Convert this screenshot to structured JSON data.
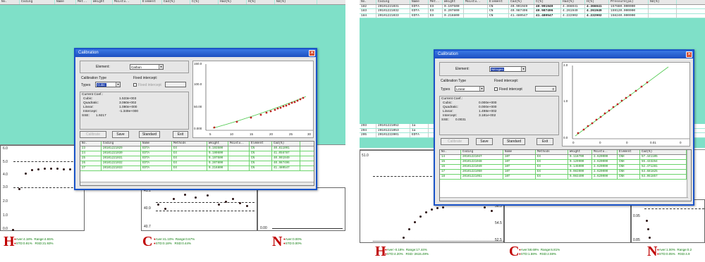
{
  "left": {
    "bg_headers": [
      "No.",
      "Coding",
      "Name",
      "Met..",
      "Weight",
      "Moistu..",
      "Element",
      "Cad(%)",
      "C(%)",
      "Had(%)",
      "H(%)",
      "Nd(%)"
    ],
    "dialog": {
      "title": "Calibration",
      "element_label": "Element:",
      "element_value": "Carbon",
      "calib_type_label": "Calibration Type",
      "types_label": "Types",
      "types_value": "Cubic",
      "fixed_intercept_label": "Fixed intercept:",
      "fixed_intercept_chk": "Fixed intercept",
      "coef_title": "Current Coef.:",
      "coefs": [
        {
          "k": "Cubic:",
          "v": "1.533e-003"
        },
        {
          "k": "Quadratic:",
          "v": "3.060e-002"
        },
        {
          "k": "Linear:",
          "v": "1.080e+000"
        },
        {
          "k": "Intercept:",
          "v": "-1.349e+000"
        },
        {
          "k": "SSE:",
          "v": "1.9217"
        }
      ],
      "buttons": {
        "calibrate": "Calibrate",
        "save": "Save",
        "standard": "Standard",
        "exit": "Exit"
      },
      "plot": {
        "y_ticks": [
          "150.0",
          "100.0",
          "50.00",
          "0.000"
        ],
        "x_ticks": [
          "5",
          "10",
          "15",
          "20",
          "25",
          "30"
        ]
      },
      "table_headers": [
        "No.",
        "Coding",
        "Name",
        "Methods",
        "Weight",
        "Moistu..",
        "Element",
        "Cad(%)"
      ],
      "rows": [
        [
          "23",
          "20101221029",
          "EDTA",
          "EX",
          "0.193500",
          "",
          "CN",
          "40.811091"
        ],
        [
          "24",
          "20101221030",
          "EDTA",
          "EX",
          "0.190600",
          "",
          "CN",
          "41.056787"
        ],
        [
          "25",
          "20101221031",
          "EDTA",
          "EX",
          "0.197500",
          "",
          "CN",
          "40.991949"
        ],
        [
          "26",
          "20101221032",
          "EDTA",
          "EX",
          "0.207800",
          "",
          "CN",
          "40.987496"
        ],
        [
          "27",
          "20101221033",
          "EDTA",
          "EX",
          "0.216800",
          "",
          "CN",
          "41.480547"
        ]
      ]
    },
    "panels": {
      "h": {
        "y_ticks": [
          "6.0",
          "5.0",
          "4.0",
          "3.0",
          "2.0",
          "1.0",
          "0.0"
        ]
      },
      "c": {
        "y_ticks": [
          "41.1",
          "40.9",
          "40.7"
        ]
      },
      "n": {
        "y_ticks": [
          "0.00"
        ]
      }
    },
    "stats": {
      "h": {
        "letter": "H",
        "l1a": "Aver:4.18%",
        "l1b": "Range:4.65%",
        "l2a": "STD:0.91%",
        "l2b": "RSD:21.93%"
      },
      "c": {
        "letter": "C",
        "l1a": "Aver:41.10%",
        "l1b": "Range:0.67%",
        "l2a": "STD:0.18%",
        "l2b": "RSD:0.44%"
      },
      "n": {
        "letter": "N",
        "l1a": "Aver:0.00%",
        "l1b": "",
        "l2a": "STD:0.00%",
        "l2b": ""
      }
    }
  },
  "right": {
    "bg_headers": [
      "No.",
      "Coding",
      "Name",
      "Met..",
      "Weight",
      "Moistu..",
      "Element",
      "Cad(%)",
      "C(%)",
      "Had(%)",
      "H(%)",
      "Pressure(pa)",
      "Nd(%)"
    ],
    "bg_rows": [
      [
        "182",
        "20101221031",
        "EDTA",
        "EX",
        "0.197500",
        "",
        "CN",
        "40.991949",
        "40.991949",
        "4.366041",
        "4.366041",
        "157880.000000",
        ""
      ],
      [
        "183",
        "20101221032",
        "EDTA",
        "EX",
        "0.207800",
        "",
        "CN",
        "40.987496",
        "40.987496",
        "4.261949",
        "4.261949",
        "159120.000000",
        ""
      ],
      [
        "184",
        "20101221033",
        "EDTA",
        "EX",
        "0.216800",
        "",
        "CN",
        "41.480547",
        "41.480547",
        "4.222902",
        "4.222902",
        "158240.000000",
        ""
      ]
    ],
    "bg_rows_lower": [
      [
        "203",
        "20101221052",
        "1a",
        ""
      ],
      [
        "204",
        "20101221053",
        "1a",
        ""
      ],
      [
        "205",
        "20101222001",
        "EDTA",
        ""
      ]
    ],
    "dialog": {
      "title": "Calibration",
      "element_label": "Element:",
      "element_value": "Nitrogen",
      "calib_type_label": "Calibration Type",
      "types_label": "Types",
      "types_value": "Linear",
      "fixed_intercept_label": "Fixed intercept:",
      "fixed_intercept_chk": "Fixed intercept",
      "fixed_intercept_value": "0",
      "coef_title": "Current Coef.:",
      "coefs": [
        {
          "k": "Cubic:",
          "v": "0.000e+000"
        },
        {
          "k": "Quadratic:",
          "v": "0.000e+000"
        },
        {
          "k": "Linear:",
          "v": "1.498e+002"
        },
        {
          "k": "Intercept:",
          "v": "3.181e-002"
        },
        {
          "k": "SSE:",
          "v": "0.0031"
        }
      ],
      "buttons": {
        "calibrate": "Calibrate",
        "save": "Save",
        "standard": "Standard",
        "exit": "Exit"
      },
      "plot": {
        "y_ticks": [
          "2.0",
          "1.0",
          "0.0"
        ],
        "x_ticks": [
          "0",
          "0",
          "0",
          "0.01",
          "0"
        ]
      },
      "table_headers": [
        "No.",
        "Coding",
        "Name",
        "Methods",
        "Weight",
        "Moistu..",
        "Element",
        "Cad(%)"
      ],
      "rows": [
        [
          "14",
          "20101221047",
          "10f",
          "EX",
          "0.118700",
          "2.620000",
          "CNH",
          "57.441105"
        ],
        [
          "15",
          "20101221048",
          "10f",
          "EX",
          "0.129900",
          "2.620000",
          "CNH",
          "55.433264"
        ],
        [
          "16",
          "20101221049",
          "10f",
          "EX",
          "0.145000",
          "2.620000",
          "CNH",
          "52.471281"
        ],
        [
          "17",
          "20101221050",
          "10f",
          "EX",
          "0.083900",
          "2.620000",
          "CNH",
          "63.681825"
        ],
        [
          "18",
          "20101221051",
          "10f",
          "EX",
          "0.083400",
          "2.620000",
          "CNH",
          "63.951857"
        ]
      ]
    },
    "panels": {
      "h": {
        "y_ticks": [
          "51.0"
        ]
      },
      "c": {
        "y_ticks": [
          "56.5",
          "54.5",
          "52.5"
        ]
      },
      "n": {
        "y_ticks": [
          "0.95",
          "0.85"
        ]
      }
    },
    "stats": {
      "h": {
        "letter": "H",
        "l1a": "Aver:-0.18%",
        "l1b": "Range:17.44%",
        "l2a": "STD:4.20%",
        "l2b": "RSD:-2615.49%"
      },
      "c": {
        "letter": "C",
        "l1a": "Aver:58.69%",
        "l1b": "Range:6.81%",
        "l2a": "STD:1.59%",
        "l2b": "RSD:2.59%"
      },
      "n": {
        "letter": "N",
        "l1a": "Aver:1.00%",
        "l1b": "Range:0.2",
        "l2a": "STD:0.05%",
        "l2b": "RSD:4.9"
      }
    }
  }
}
